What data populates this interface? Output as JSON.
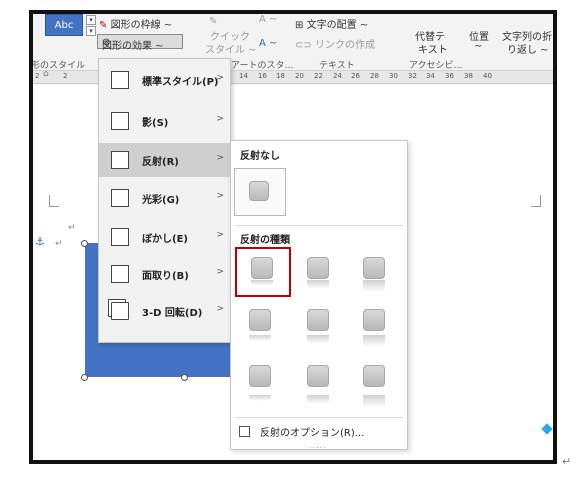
{
  "ribbon": {
    "abc_tile": "Abc",
    "shape_outline": "図形の枠線 ~",
    "shape_effects": "図形の効果 ~",
    "quick_style_line1": "クイック",
    "quick_style_line2": "スタイル ~",
    "text_direction": "文字の配置 ~",
    "create_link": "リンクの作成",
    "alt_text_line1": "代替テ",
    "alt_text_line2": "キスト",
    "position": "位置",
    "position_arrow": "~",
    "wrap_text_line1": "文字列の折",
    "wrap_text_line2": "り返し ~",
    "group_shape_styles": "形のスタイル",
    "group_wordart": "アートのスタ…",
    "group_text": "テキスト",
    "group_accessibility": "アクセシビ…",
    "font_a": "A",
    "font_a_arrow": "~",
    "ruler_ticks": [
      "2",
      "2",
      "14",
      "16",
      "18",
      "20",
      "22",
      "24",
      "26",
      "28",
      "30",
      "32",
      "34",
      "36",
      "38",
      "40"
    ]
  },
  "menu": {
    "items": [
      {
        "label": "標準スタイル(P)",
        "arrow": ">"
      },
      {
        "label": "影(S)",
        "arrow": ">"
      },
      {
        "label": "反射(R)",
        "arrow": ">"
      },
      {
        "label": "光彩(G)",
        "arrow": ">"
      },
      {
        "label": "ぼかし(E)",
        "arrow": ">"
      },
      {
        "label": "面取り(B)",
        "arrow": ">"
      },
      {
        "label": "3-D 回転(D)",
        "arrow": ">"
      }
    ]
  },
  "gallery": {
    "no_reflection": "反射なし",
    "variations": "反射の種類",
    "options": "反射のオプション(R)...",
    "grip": "....."
  },
  "colors": {
    "accent": "#4472c4",
    "selection": "#c00000"
  }
}
